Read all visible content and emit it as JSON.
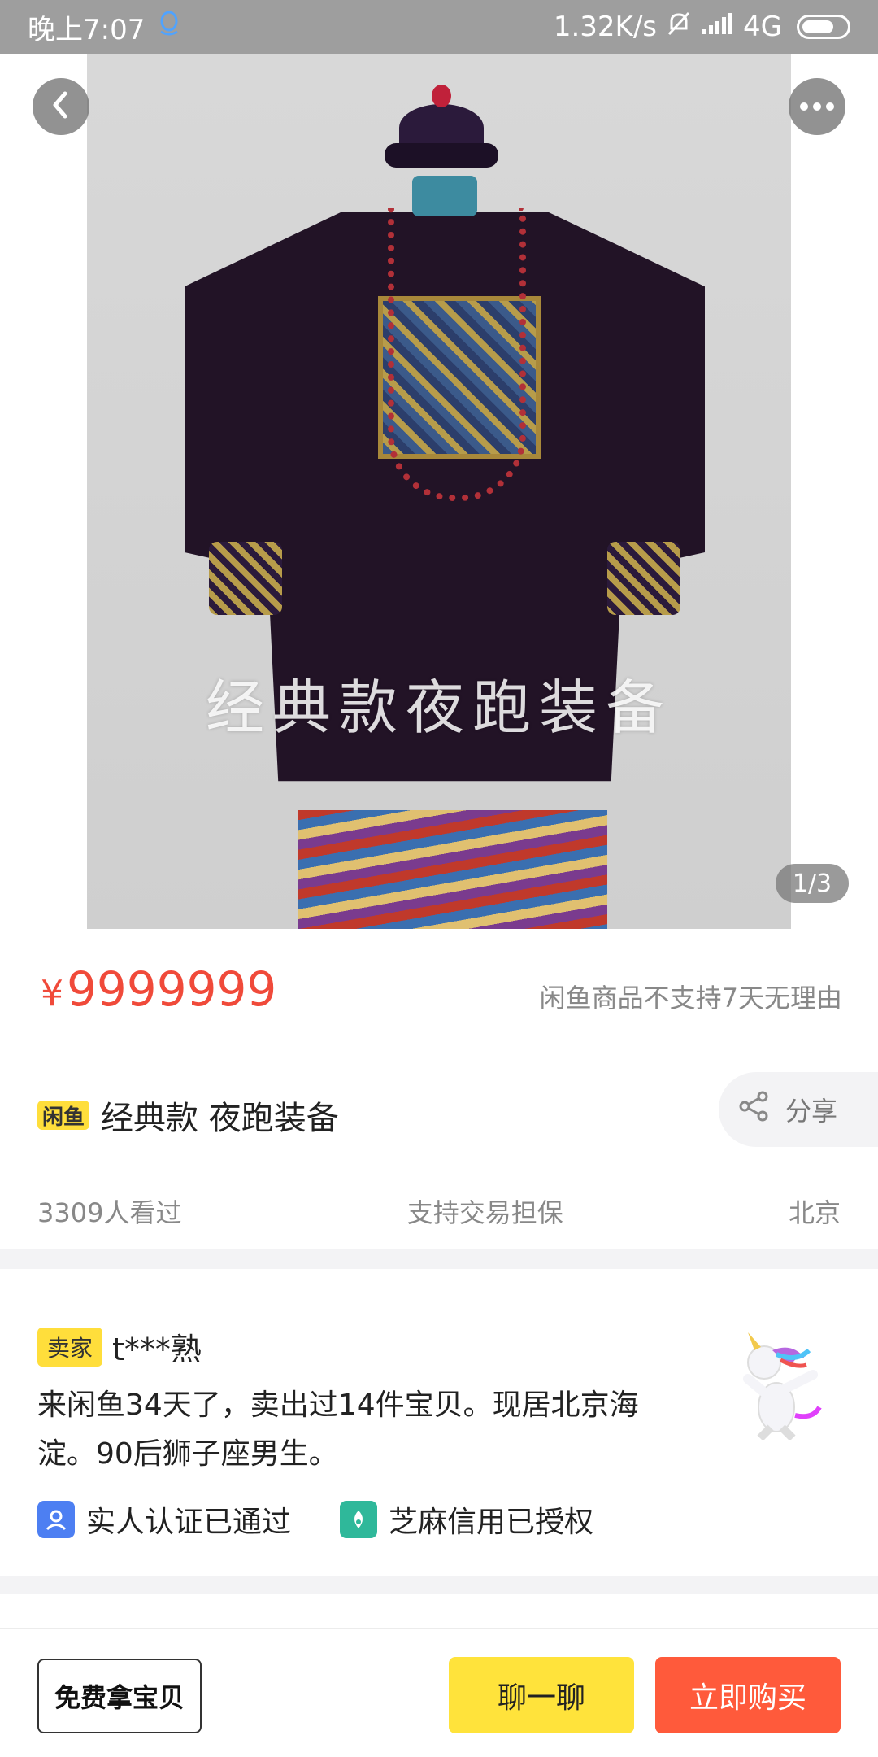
{
  "status_bar": {
    "time": "晚上7:07",
    "speed": "1.32K/s",
    "network": "4G"
  },
  "gallery": {
    "watermark": "经典款夜跑装备",
    "page_indicator": "1/3"
  },
  "product": {
    "price_symbol": "¥",
    "price": "9999999",
    "policy": "闲鱼商品不支持7天无理由",
    "platform_tag": "闲鱼",
    "title": "经典款 夜跑装备",
    "share_label": "分享",
    "views": "3309人看过",
    "guarantee": "支持交易担保",
    "location": "北京"
  },
  "seller": {
    "badge": "卖家",
    "name": "t***熟",
    "description": "来闲鱼34天了，卖出过14件宝贝。现居北京海淀。90后狮子座男生。",
    "verifications": [
      {
        "label": "实人认证已通过",
        "icon": "person-verify-icon",
        "color": "#4d7ff2"
      },
      {
        "label": "芝麻信用已授权",
        "icon": "sesame-credit-icon",
        "color": "#2fb89a"
      }
    ]
  },
  "bottom_bar": {
    "free_label": "免费拿宝贝",
    "chat_label": "聊一聊",
    "buy_label": "立即购买"
  },
  "colors": {
    "price": "#f04a3a",
    "accent_yellow": "#ffe33b",
    "buy_red": "#ff5a3b"
  }
}
